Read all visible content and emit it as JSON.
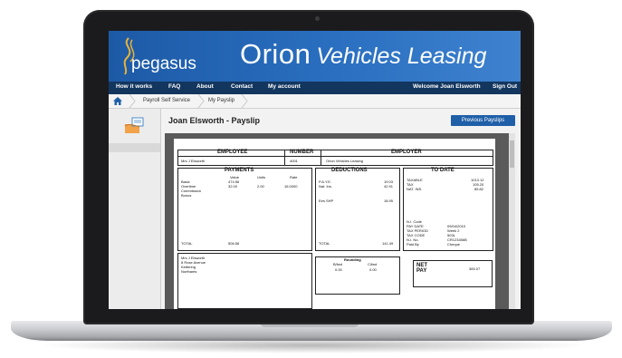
{
  "app": {
    "logo_text": "pegasus",
    "brand_main": "Orion",
    "brand_sub": "Vehicles Leasing",
    "accent_color": "#1f5fa8"
  },
  "nav": {
    "items": [
      "How it works",
      "FAQ",
      "About",
      "Contact",
      "My account"
    ],
    "welcome": "Welcome Joan Elsworth",
    "signout": "Sign Out"
  },
  "breadcrumb": {
    "items": [
      "Payroll Self Service",
      "My Payslip"
    ]
  },
  "page": {
    "title": "Joan Elsworth - Payslip",
    "previous_button": "Previous Payslips"
  },
  "payslip": {
    "employee_header": "EMPLOYEE",
    "number_header": "NUMBER",
    "employer_header": "EMPLOYER",
    "employee_name": "Mrs J Elsworth",
    "number": "4001",
    "employer_name": "Orion Vehicles Leasing",
    "payments_header": "PAYMENTS",
    "value_col": "Value",
    "units_col": "Units",
    "rate_col": "Rate",
    "payments": [
      {
        "name": "Basic",
        "value": "474.56",
        "units": "",
        "rate": ""
      },
      {
        "name": "Overtime",
        "value": "32.00",
        "units": "2.00",
        "rate": "16.0000"
      },
      {
        "name": "Commission",
        "value": "",
        "units": "",
        "rate": ""
      },
      {
        "name": "Bonus",
        "value": "",
        "units": "",
        "rate": ""
      }
    ],
    "payments_total_label": "TOTAL",
    "payments_total": "506.56",
    "deductions_header": "DEDUCTIONS",
    "deductions": [
      {
        "name": "P.A.Y.E.",
        "value": "19.03"
      },
      {
        "name": "Nat. Ins.",
        "value": "42.91"
      }
    ],
    "ees_shp_label": "Ees SHP",
    "ees_shp_value": "18.95",
    "deductions_total_label": "TOTAL",
    "deductions_total": "141.49",
    "todate_header": "TO DATE",
    "todate": [
      {
        "name": "TAXABLE",
        "value": "1013.12"
      },
      {
        "name": "TAX",
        "value": "105.20"
      },
      {
        "name": "NAT. INS.",
        "value": "85.82"
      }
    ],
    "info": [
      {
        "name": "N.I. Code",
        "value": ""
      },
      {
        "name": "PAY DATE",
        "value": "09/04/2010"
      },
      {
        "name": "TAX PERIOD",
        "value": "Week    2"
      },
      {
        "name": "TAX CODE",
        "value": "503L"
      },
      {
        "name": "N.I. No.",
        "value": "CR123456B"
      },
      {
        "name": "Paid By",
        "value": "Cheque"
      }
    ],
    "address": [
      "Mrs J Elsworth",
      "8 Rose Avenue",
      "Kettering",
      "Northants"
    ],
    "rounding_header": "Rounding",
    "rounding_bf_label": "B/fwd",
    "rounding_cf_label": "C/fwd",
    "rounding_bf": "0.00",
    "rounding_cf": "0.00",
    "net_label_1": "NET",
    "net_label_2": "PAY",
    "net_value": "365.07"
  }
}
